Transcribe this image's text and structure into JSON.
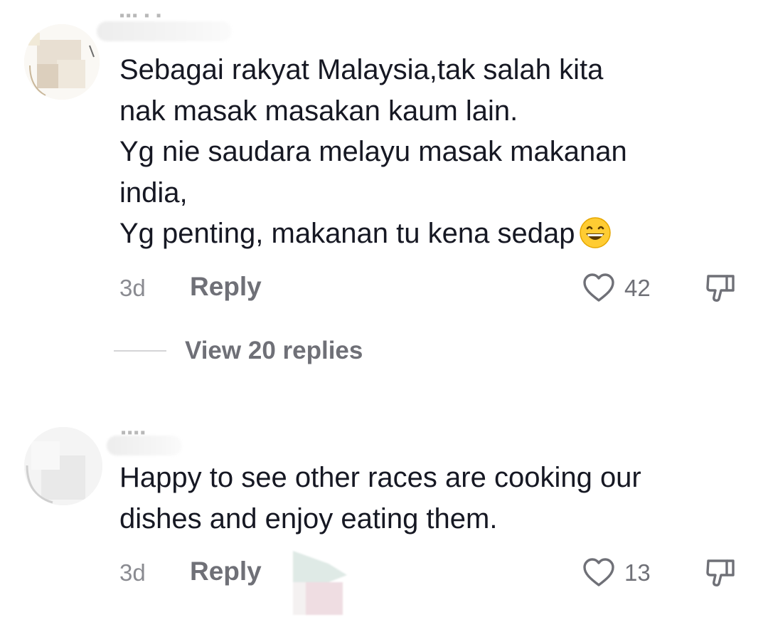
{
  "comments": [
    {
      "text_lines": [
        "Sebagai rakyat Malaysia,tak salah kita",
        "nak masak masakan kaum lain.",
        "Yg nie saudara melayu masak makanan",
        "india,",
        "Yg penting, makanan tu kena sedap"
      ],
      "emoji": "grinning-face-emoji",
      "time": "3d",
      "reply_label": "Reply",
      "like_count": "42",
      "view_replies_label": "View 20 replies"
    },
    {
      "text_lines": [
        "Happy to see other races are cooking our",
        "dishes and enjoy eating them."
      ],
      "time": "3d",
      "reply_label": "Reply",
      "like_count": "13"
    }
  ],
  "icons": {
    "like": "heart-outline-icon",
    "dislike": "thumbs-down-outline-icon"
  },
  "colors": {
    "primary_text": "#161823",
    "secondary_text": "#8a8b91",
    "action_text": "#6f7077"
  }
}
